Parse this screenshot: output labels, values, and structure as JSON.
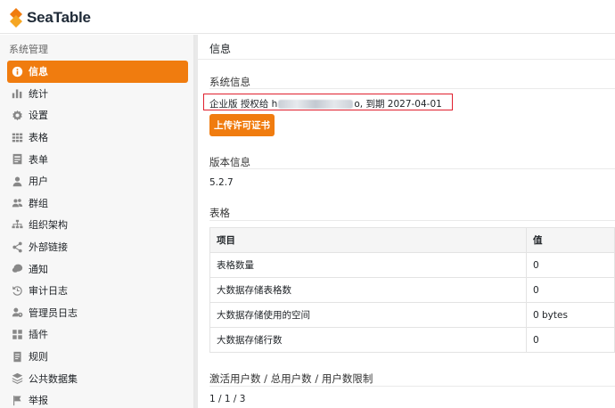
{
  "brand": {
    "name": "SeaTable",
    "accent": "#f07c0f"
  },
  "sidebar": {
    "heading": "系统管理",
    "items": [
      {
        "label": "信息",
        "icon": "info-icon",
        "active": true
      },
      {
        "label": "统计",
        "icon": "bar-chart-icon"
      },
      {
        "label": "设置",
        "icon": "gear-icon"
      },
      {
        "label": "表格",
        "icon": "grid-icon"
      },
      {
        "label": "表单",
        "icon": "form-icon"
      },
      {
        "label": "用户",
        "icon": "user-icon"
      },
      {
        "label": "群组",
        "icon": "group-icon"
      },
      {
        "label": "组织架构",
        "icon": "org-chart-icon"
      },
      {
        "label": "外部链接",
        "icon": "share-icon"
      },
      {
        "label": "通知",
        "icon": "chat-icon"
      },
      {
        "label": "审计日志",
        "icon": "history-icon"
      },
      {
        "label": "管理员日志",
        "icon": "admin-log-icon"
      },
      {
        "label": "插件",
        "icon": "plugin-icon"
      },
      {
        "label": "规则",
        "icon": "rules-icon"
      },
      {
        "label": "公共数据集",
        "icon": "layers-icon"
      },
      {
        "label": "举报",
        "icon": "flag-icon"
      }
    ]
  },
  "main": {
    "title": "信息",
    "system_info": {
      "title": "系统信息",
      "license_prefix": "企业版 授权给 h",
      "license_suffix": "o, 到期 2027-04-01",
      "upload_label": "上传许可证书"
    },
    "version": {
      "title": "版本信息",
      "value": "5.2.7"
    },
    "tables": {
      "title": "表格",
      "headers": [
        "项目",
        "值"
      ],
      "rows": [
        [
          "表格数量",
          "0"
        ],
        [
          "大数据存储表格数",
          "0"
        ],
        [
          "大数据存储使用的空间",
          "0 bytes"
        ],
        [
          "大数据存储行数",
          "0"
        ]
      ]
    },
    "users": {
      "title": "激活用户数 / 总用户数 / 用户数限制",
      "value": "1 / 1 / 3"
    }
  }
}
